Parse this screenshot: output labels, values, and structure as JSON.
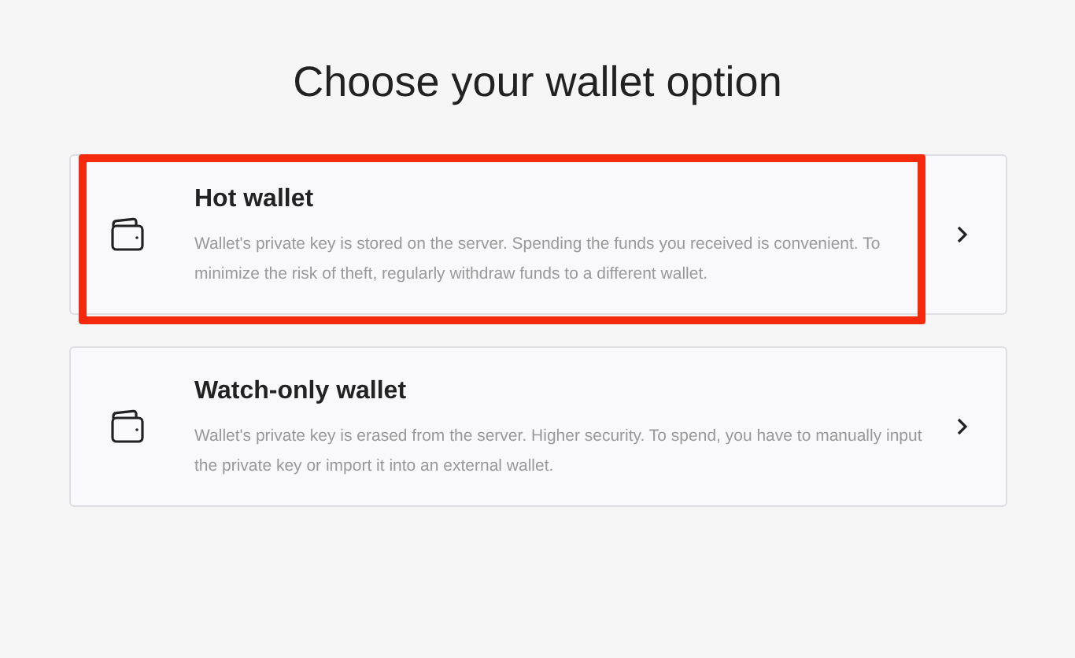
{
  "title": "Choose your wallet option",
  "options": [
    {
      "name": "Hot wallet",
      "description": "Wallet's private key is stored on the server. Spending the funds you received is convenient. To minimize the risk of theft, regularly withdraw funds to a different wallet.",
      "highlighted": true
    },
    {
      "name": "Watch-only wallet",
      "description": "Wallet's private key is erased from the server. Higher security. To spend, you have to manually input the private key or import it into an external wallet.",
      "highlighted": false
    }
  ]
}
